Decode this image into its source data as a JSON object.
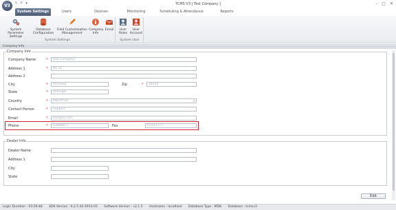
{
  "window": {
    "logo_text": "V3",
    "title": "TCMS V3 [ Test Company ]",
    "qat": [
      "↑",
      "↶",
      "▾"
    ],
    "controls": [
      "–",
      "□",
      "✕"
    ]
  },
  "tabs": [
    {
      "label": "System Settings",
      "active": true
    },
    {
      "label": "Users",
      "active": false
    },
    {
      "label": "Devices",
      "active": false
    },
    {
      "label": "Monitoring",
      "active": false
    },
    {
      "label": "Scheduling & Attendance",
      "active": false
    },
    {
      "label": "Reports",
      "active": false
    }
  ],
  "ribbon": {
    "system_settings_group": "System Settings",
    "system_user_group": "System User",
    "buttons": [
      {
        "label1": "System Parameter",
        "label2": "Settings",
        "icon": "gears-icon"
      },
      {
        "label1": "Database",
        "label2": "Configuration",
        "icon": "database-icon"
      },
      {
        "label1": "Field Customization",
        "label2": "Management",
        "icon": "pencil-icon"
      },
      {
        "label1": "Company",
        "label2": "Info",
        "icon": "company-info-icon"
      },
      {
        "label1": "Email",
        "label2": "",
        "icon": "email-icon"
      },
      {
        "label1": "User",
        "label2": "Roles",
        "icon": "user-roles-icon"
      },
      {
        "label1": "User",
        "label2": "Account",
        "icon": "user-account-icon"
      }
    ]
  },
  "section_title": "Company Info",
  "company": {
    "group_title": "Company Info",
    "company_name_label": "Company Name",
    "company_name_value": "Test Company",
    "address1_label": "Address 1",
    "address1_value": "No 10",
    "address2_label": "Address 2",
    "address2_value": "",
    "city_label": "City",
    "city_value": "Puchong",
    "zip_label": "Zip",
    "zip_value": "28150",
    "state_label": "State",
    "state_value": "Selangor",
    "country_label": "Country",
    "country_value": "MALAYSIA",
    "contact_label": "Contact Person",
    "contact_value": "Support",
    "email_label": "Email",
    "email_value": "test@ss.com",
    "phone_label": "Phone",
    "phone_value": "03888877",
    "fax_label": "Fax",
    "fax_value": "03333777",
    "required_mark": "*"
  },
  "dealer": {
    "group_title": "Dealer Info",
    "name_label": "Dealer Name",
    "address1_label": "Address 1",
    "city_label": "City",
    "state_label": "State"
  },
  "edit_button": "Edit",
  "status": {
    "login": "Login Duration : 03:59:48",
    "sdk": "SDK Version : 6.2.5.42-4913-03",
    "software": "Software Version : v2.1.5",
    "hostname": "Hostname : localhost",
    "dbtype": "Database Type : MDB",
    "database": "Database : tcmsv3"
  },
  "colors": {
    "accent": "#4f5d75",
    "highlight": "#d1202a",
    "required": "#dd2233"
  }
}
